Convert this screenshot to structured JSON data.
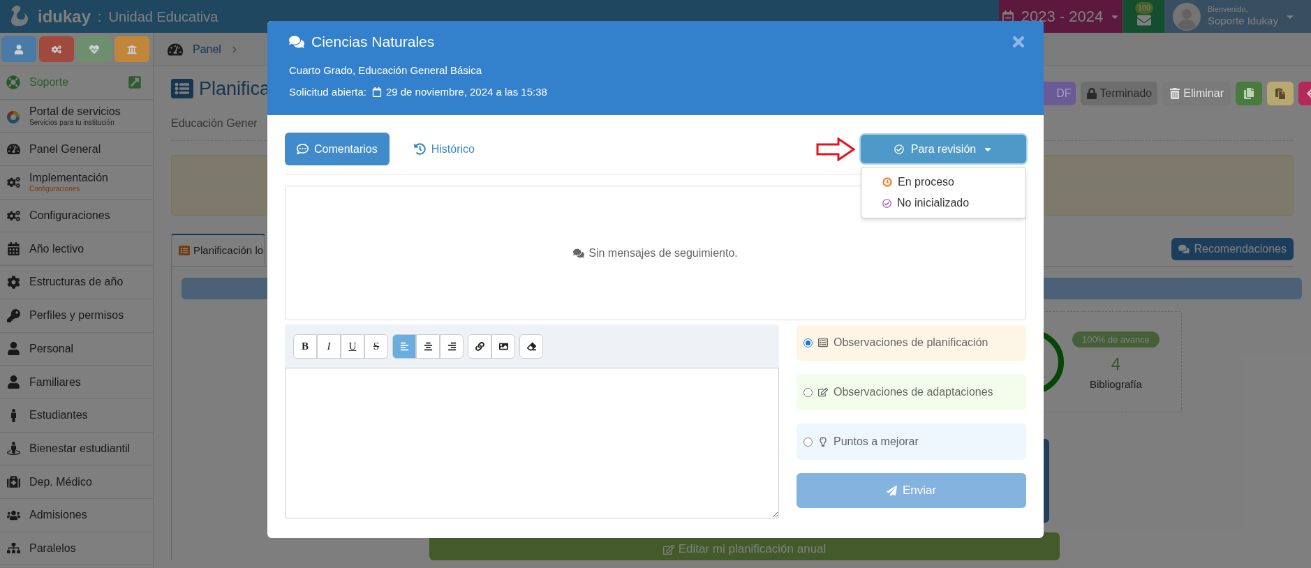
{
  "topbar": {
    "brand": "idukay",
    "separator": ":",
    "institution": "Unidad Educativa",
    "school_year": "2023 - 2024",
    "messages_badge": "100",
    "greeting": "Bienvenido,",
    "user": "Soporte Idukay"
  },
  "sidebar": {
    "shortcuts": [
      {
        "color": "#4a7aa6"
      },
      {
        "color": "#a04a3e"
      },
      {
        "color": "#6e8f6e"
      },
      {
        "color": "#c0873a"
      }
    ],
    "items": [
      {
        "label": "Soporte",
        "kind": "support"
      },
      {
        "label": "Portal de servicios",
        "sublabel": "Servicios para tu institución",
        "kind": "portal"
      },
      {
        "label": "Panel General",
        "kind": "item"
      },
      {
        "label": "Implementación",
        "sublabel": "Configuraciones",
        "kind": "flagged"
      },
      {
        "label": "Configuraciones",
        "kind": "item"
      },
      {
        "label": "Año lectivo",
        "kind": "item"
      },
      {
        "label": "Estructuras de año",
        "kind": "item"
      },
      {
        "label": "Perfiles y permisos",
        "kind": "item"
      },
      {
        "label": "Personal",
        "kind": "item"
      },
      {
        "label": "Familiares",
        "kind": "item"
      },
      {
        "label": "Estudiantes",
        "kind": "item"
      },
      {
        "label": "Bienestar estudiantil",
        "kind": "item"
      },
      {
        "label": "Dep. Médico",
        "kind": "item"
      },
      {
        "label": "Admisiones",
        "kind": "item"
      },
      {
        "label": "Paralelos",
        "kind": "item"
      }
    ]
  },
  "breadcrumb": [
    "Panel"
  ],
  "page": {
    "title": "Planifica",
    "subtitle": "Educación Gener",
    "actions": [
      {
        "kind": "text",
        "label": "DF",
        "color": "#6a5a96",
        "disabled": false
      },
      {
        "kind": "lock",
        "label": "Terminado",
        "color": "#6e6e6e",
        "disabled": false
      },
      {
        "kind": "trash",
        "label": "Eliminar",
        "color": "#7a7a7a",
        "disabled": true
      },
      {
        "kind": "copy",
        "color": "#4a7a3e",
        "disabled": false
      },
      {
        "kind": "paste",
        "color": "#b8a872",
        "disabled": false
      },
      {
        "kind": "back",
        "color": "#b02a5a",
        "disabled": false
      }
    ],
    "tabs": [
      {
        "label": "Planificación lo",
        "selected": true
      }
    ],
    "recommendations_button": "Recomendaciones",
    "progress": {
      "badge": "100% de avance",
      "count": "4",
      "count_label": "Bibliografía"
    },
    "edit_button": "Editar mi planificación anual"
  },
  "modal": {
    "title": "Ciencias Naturales",
    "subtitle": "Cuarto Grado, Educación General Básica",
    "opened_label": "Solicitud abierta:",
    "opened_date": "29 de noviembre, 2024 a las 15:38",
    "tabs": [
      {
        "label": "Comentarios",
        "selected": true
      },
      {
        "label": "Histórico",
        "selected": false
      }
    ],
    "status_button": "Para revisión",
    "status_menu": {
      "expanded": true,
      "options": [
        {
          "label": "En proceso",
          "kind": "clock",
          "color": "#f0883a"
        },
        {
          "label": "No inicializado",
          "kind": "check",
          "color": "#9b59b6"
        }
      ]
    },
    "empty_message": "Sin mensajes de seguimiento.",
    "editor_toolbar": [
      [
        {
          "kind": "bold",
          "label": "B",
          "selected": false
        },
        {
          "kind": "italic",
          "label": "I",
          "selected": false
        },
        {
          "kind": "underline",
          "label": "U",
          "selected": false
        },
        {
          "kind": "strike",
          "label": "S",
          "selected": false
        }
      ],
      [
        {
          "kind": "align-left",
          "selected": true
        },
        {
          "kind": "align-center",
          "selected": false
        },
        {
          "kind": "align-right",
          "selected": false
        }
      ],
      [
        {
          "kind": "link",
          "selected": false
        },
        {
          "kind": "image",
          "selected": false
        }
      ],
      [
        {
          "kind": "eraser",
          "selected": false
        }
      ]
    ],
    "categories": [
      {
        "label": "Observaciones de planificación",
        "kind": "list",
        "color": "#fdf6e6",
        "selected": true
      },
      {
        "label": "Observaciones de adaptaciones",
        "kind": "edit",
        "color": "#f3fdec",
        "selected": false
      },
      {
        "label": "Puntos a mejorar",
        "kind": "bulb",
        "color": "#eef6fe",
        "selected": false
      }
    ],
    "send_button": "Enviar"
  }
}
